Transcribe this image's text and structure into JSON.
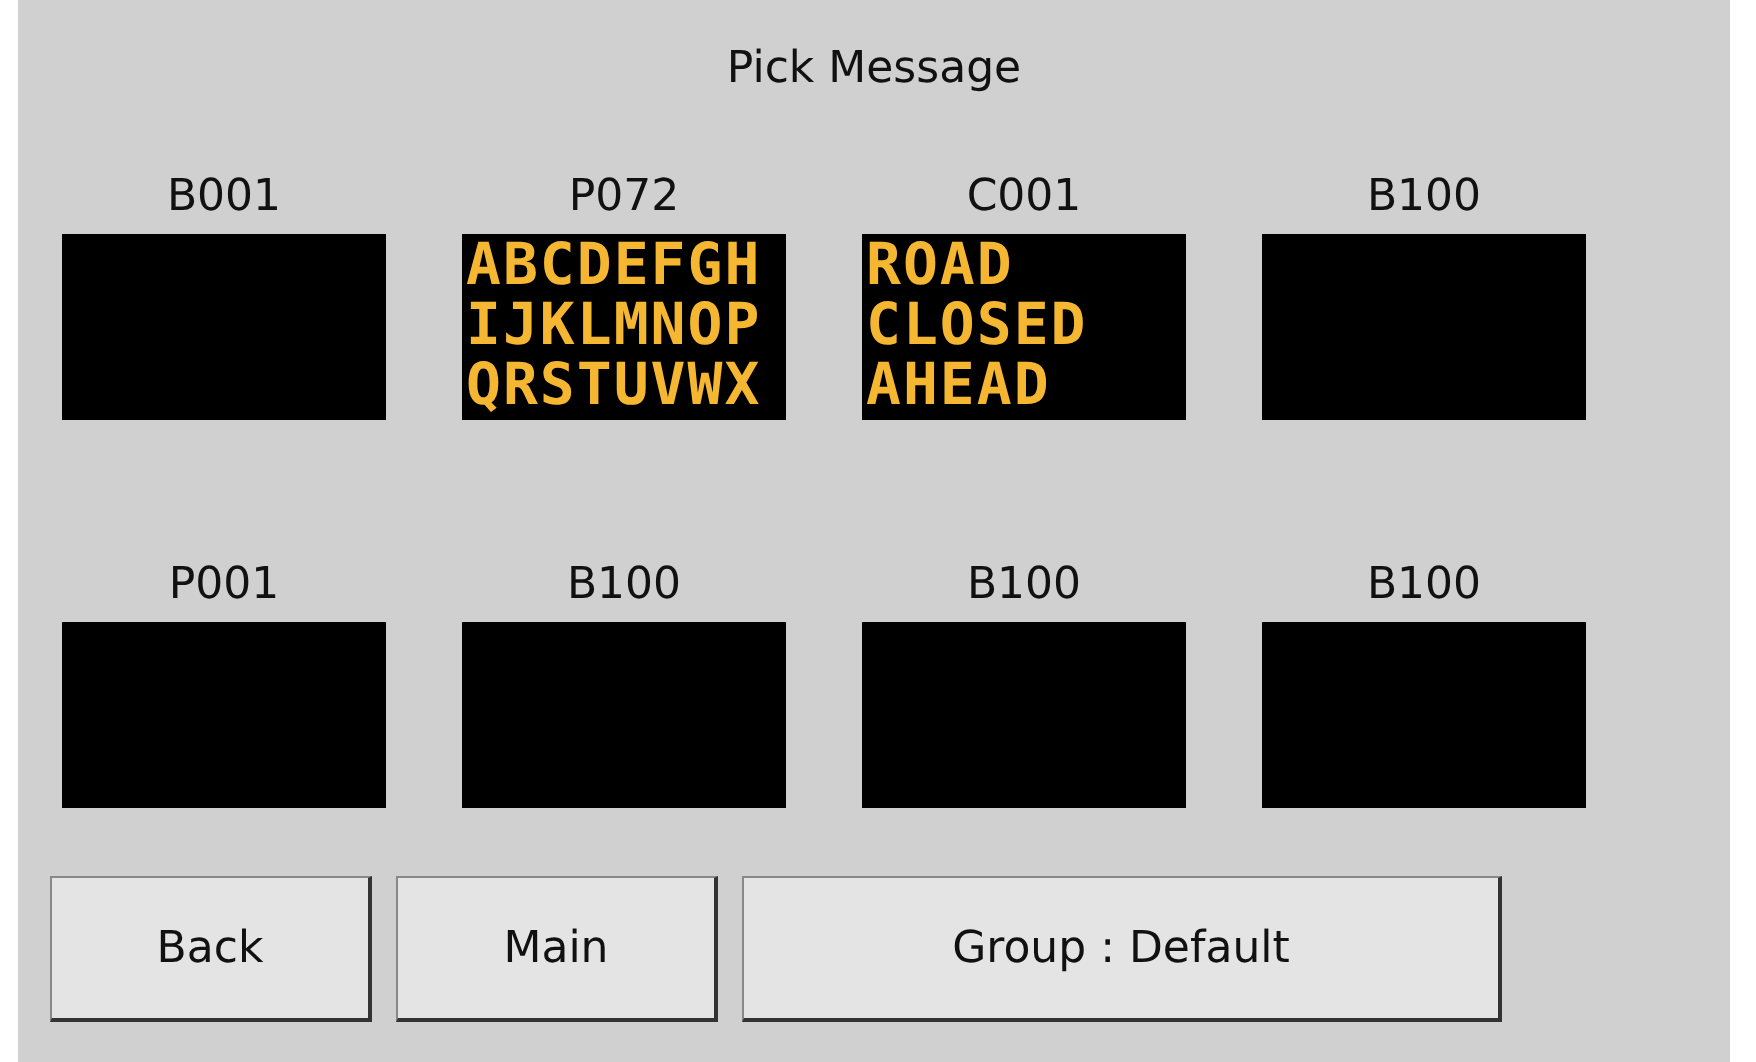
{
  "title": "Pick Message",
  "messages": [
    {
      "code": "B001"
    },
    {
      "code": "P072",
      "lines": [
        "ABCDEFGH",
        "IJKLMNOP",
        "QRSTUVWX"
      ]
    },
    {
      "code": "C001",
      "lines": [
        "ROAD",
        "CLOSED",
        "AHEAD"
      ]
    },
    {
      "code": "B100"
    },
    {
      "code": "P001"
    },
    {
      "code": "B100"
    },
    {
      "code": "B100"
    },
    {
      "code": "B100"
    }
  ],
  "buttons": [
    {
      "label": "Back",
      "kind": "small"
    },
    {
      "label": "Main",
      "kind": "small"
    },
    {
      "label": "Group : Default",
      "kind": "wide"
    }
  ]
}
